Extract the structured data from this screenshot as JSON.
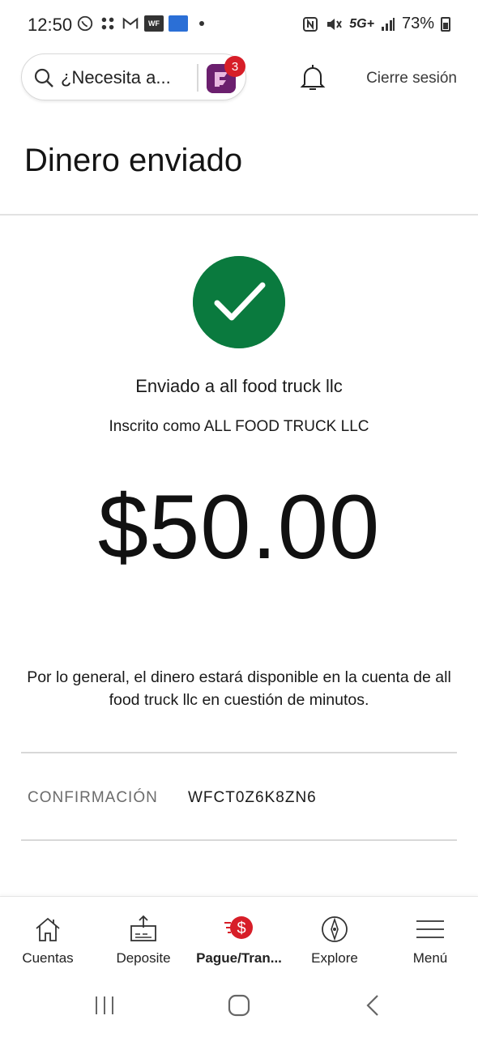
{
  "status_bar": {
    "time": "12:50",
    "network": "5G+",
    "battery": "73%",
    "left_icons": [
      "whatsapp-icon",
      "apps-icon",
      "gmail-icon",
      "wf-icon",
      "creditcard-app-icon",
      "dot-icon"
    ],
    "right_icons": [
      "nfc-icon",
      "mute-icon",
      "signal-icon",
      "battery-icon"
    ]
  },
  "header": {
    "search_placeholder": "¿Necesita a...",
    "notification_count": "3",
    "logout_label": "Cierre sesión"
  },
  "page": {
    "title": "Dinero enviado"
  },
  "confirmation": {
    "sent_to": "Enviado a all food truck llc",
    "enrolled_as": "Inscrito como ALL FOOD TRUCK LLC",
    "amount": "$50.00",
    "note": "Por lo general, el dinero estará disponible en la cuenta de all food truck llc en cuestión de minutos.",
    "confirmation_label": "CONFIRMACIÓN",
    "confirmation_number": "WFCT0Z6K8ZN6"
  },
  "bottom_nav": {
    "items": [
      {
        "label": "Cuentas",
        "icon": "house-icon"
      },
      {
        "label": "Deposite",
        "icon": "deposit-icon"
      },
      {
        "label": "Pague/Tran...",
        "icon": "pay-transfer-icon",
        "active": true
      },
      {
        "label": "Explore",
        "icon": "compass-icon"
      },
      {
        "label": "Menú",
        "icon": "hamburger-icon"
      }
    ]
  },
  "colors": {
    "success_green": "#0a7a3e",
    "brand_red": "#d71e28",
    "fargo_purple": "#6b1f6e"
  }
}
